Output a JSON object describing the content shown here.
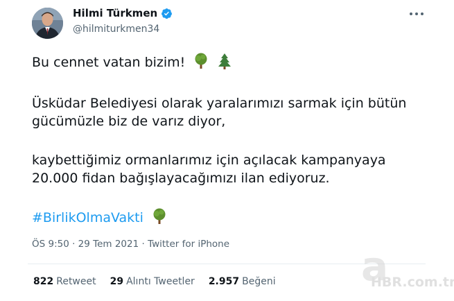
{
  "user": {
    "display_name": "Hilmi Türkmen",
    "handle": "@hilmiturkmen34"
  },
  "tweet": {
    "line1": "Bu cennet vatan bizim!",
    "para2_line1": "Üsküdar Belediyesi olarak yaralarımızı sarmak için bütün",
    "para2_line2": "gücümüzle biz de varız diyor,",
    "para3_line1": "kaybettiğimiz ormanlarımız için açılacak kampanyaya",
    "para3_line2": "20.000 fidan bağışlayacağımızı ilan ediyoruz.",
    "hashtag": "#BirlikOlmaVakti"
  },
  "meta": {
    "timestamp": "ÖS 9:50 · 29 Tem 2021 · Twitter for iPhone"
  },
  "stats": {
    "retweets_count": "822",
    "retweets_label": "Retweet",
    "quotes_count": "29",
    "quotes_label": "Alıntı Tweetler",
    "likes_count": "2.957",
    "likes_label": "Beğeni"
  },
  "watermark": {
    "brand_letter": "a",
    "brand_text": "HBR.com.tr"
  },
  "colors": {
    "link": "#1d9bf0",
    "secondary_text": "#536471",
    "verified": "#1d9bf0"
  },
  "icons": {
    "verified": "verified-badge-icon",
    "more": "more-options-icon",
    "emoji_tree": "deciduous-tree-emoji",
    "emoji_evergreen": "evergreen-tree-emoji"
  }
}
